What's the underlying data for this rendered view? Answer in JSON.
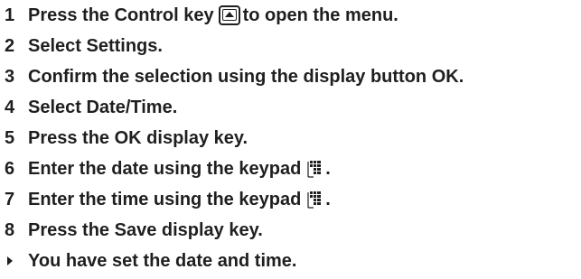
{
  "steps": [
    {
      "num": "1",
      "parts": [
        "Press the Control key",
        "to open the menu."
      ],
      "icon": "control-key-icon"
    },
    {
      "num": "2",
      "pre": "Select ",
      "bold": "Settings",
      "post": "."
    },
    {
      "num": "3",
      "pre": "Confirm the selection using the display button ",
      "bold": "OK",
      "post": "."
    },
    {
      "num": "4",
      "pre": "Select ",
      "bold": "Date/Time",
      "post": "."
    },
    {
      "num": "5",
      "pre": "Press the ",
      "bold": "OK",
      "post": " display key."
    },
    {
      "num": "6",
      "pre": "Enter the date using the keypad",
      "post": ".",
      "icon": "keypad-icon"
    },
    {
      "num": "7",
      "pre": "Enter the time using the keypad",
      "post": ".",
      "icon": "keypad-icon"
    },
    {
      "num": "8",
      "pre": "Press the ",
      "bold": "Save",
      "post": " display key."
    }
  ],
  "result": {
    "text": "You have set the date and time.",
    "icon": "result-arrow-icon"
  }
}
